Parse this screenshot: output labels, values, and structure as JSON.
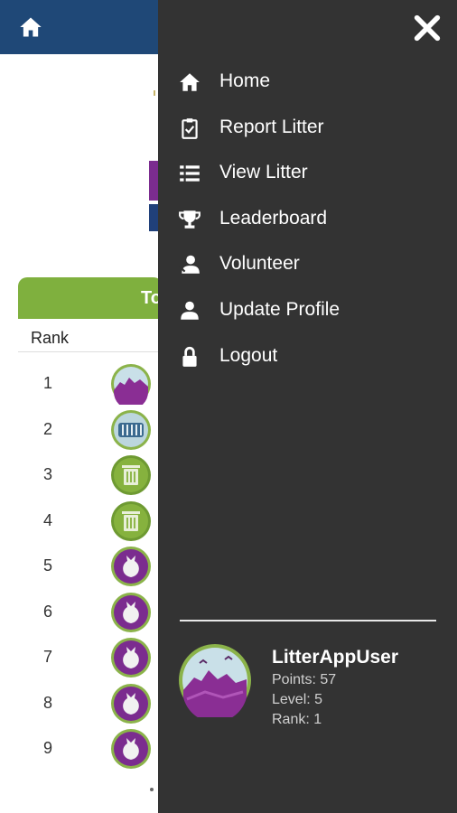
{
  "page": {
    "leaderboard_header": "To",
    "rank_column": "Rank",
    "ranks": [
      "1",
      "2",
      "3",
      "4",
      "5",
      "6",
      "7",
      "8",
      "9"
    ],
    "badges": [
      "mountain-badge",
      "crate-badge",
      "bin-badge",
      "bin-badge",
      "bag-badge",
      "bag-badge",
      "bag-badge",
      "bag-badge",
      "bag-badge"
    ]
  },
  "drawer": {
    "menu": [
      {
        "label": "Home",
        "icon": "home-icon"
      },
      {
        "label": "Report Litter",
        "icon": "clipboard-check-icon"
      },
      {
        "label": "View Litter",
        "icon": "list-icon"
      },
      {
        "label": "Leaderboard",
        "icon": "trophy-icon"
      },
      {
        "label": "Volunteer",
        "icon": "volunteer-icon"
      },
      {
        "label": "Update Profile",
        "icon": "user-icon"
      },
      {
        "label": "Logout",
        "icon": "lock-icon"
      }
    ],
    "profile": {
      "username": "LitterAppUser",
      "points": "Points: 57",
      "level": "Level: 5",
      "rank": "Rank: 1"
    }
  },
  "colors": {
    "topbar": "#1f4877",
    "drawer": "#333333",
    "green": "#7fb03e",
    "purple": "#7b2c8f"
  }
}
